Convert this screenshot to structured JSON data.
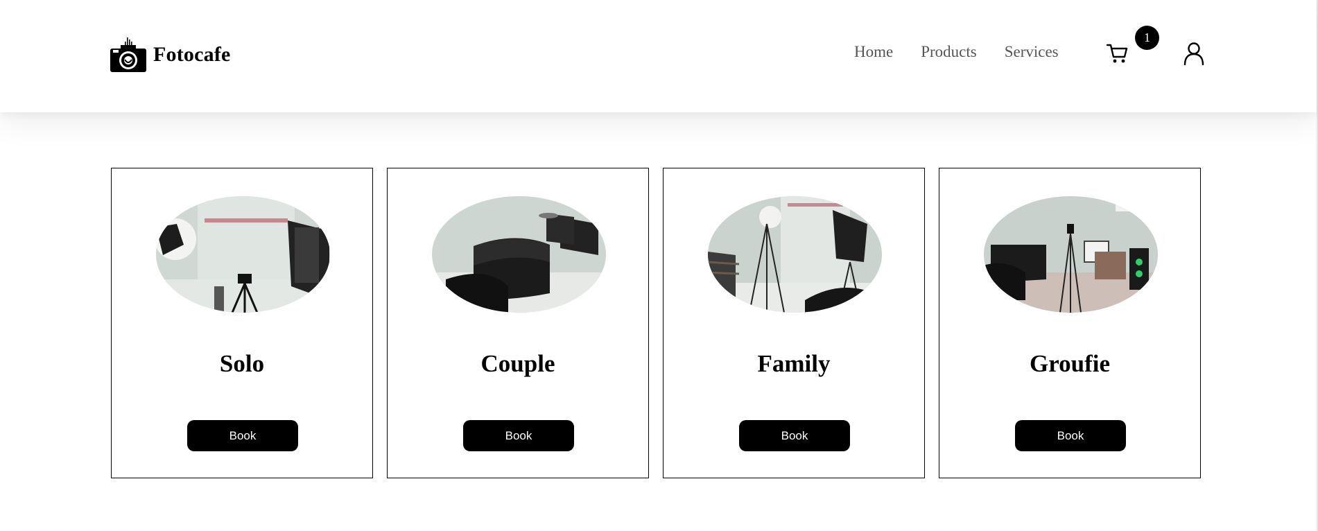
{
  "header": {
    "brand": "Fotocafe",
    "nav": [
      {
        "label": "Home",
        "icon": ""
      },
      {
        "label": "Products",
        "icon": ""
      },
      {
        "label": "Services",
        "icon": ""
      }
    ],
    "cart_icon": "cart-icon",
    "cart_count": "1",
    "user_icon": "user-icon",
    "logo_icon": "camera-logo-icon"
  },
  "cards": [
    {
      "title": "Solo",
      "button": "Book"
    },
    {
      "title": "Couple",
      "button": "Book"
    },
    {
      "title": "Family",
      "button": "Book"
    },
    {
      "title": "Groufie",
      "button": "Book"
    }
  ],
  "colors": {
    "text": "#000000",
    "nav_text": "#555555",
    "button_bg": "#000000",
    "button_text": "#ffffff",
    "page_bg": "#ffffff"
  }
}
